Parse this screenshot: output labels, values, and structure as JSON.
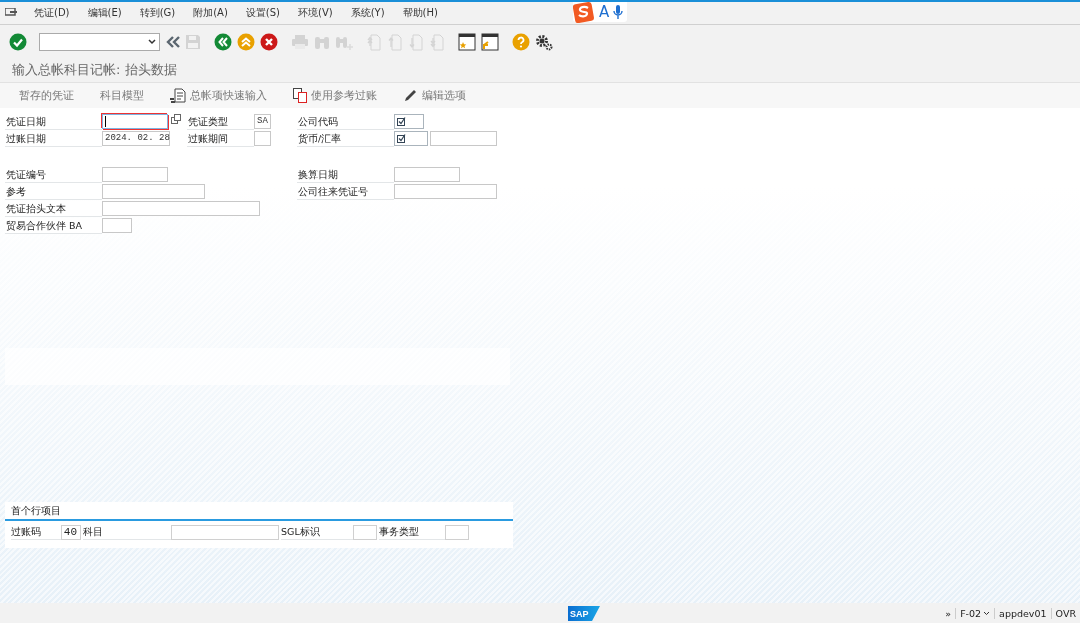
{
  "menu": [
    "凭证(D)",
    "编辑(E)",
    "转到(G)",
    "附加(A)",
    "设置(S)",
    "环境(V)",
    "系统(Y)",
    "帮助(H)"
  ],
  "ime": {
    "mode": "A"
  },
  "toolbar": [
    {
      "kind": "enter",
      "disabled": false
    },
    {
      "kind": "command-field"
    },
    {
      "kind": "collapse",
      "disabled": false
    },
    {
      "kind": "save",
      "disabled": true
    },
    {
      "kind": "back",
      "disabled": false
    },
    {
      "kind": "exit",
      "disabled": false
    },
    {
      "kind": "cancel",
      "disabled": false
    },
    {
      "kind": "print",
      "disabled": true
    },
    {
      "kind": "find",
      "disabled": true
    },
    {
      "kind": "find-next",
      "disabled": true
    },
    {
      "kind": "first-page",
      "disabled": true
    },
    {
      "kind": "prev-page",
      "disabled": true
    },
    {
      "kind": "next-page",
      "disabled": true
    },
    {
      "kind": "last-page",
      "disabled": true
    },
    {
      "kind": "new-session",
      "disabled": false
    },
    {
      "kind": "shortcut",
      "disabled": false
    },
    {
      "kind": "help",
      "disabled": false
    },
    {
      "kind": "settings",
      "disabled": false
    }
  ],
  "title": "输入总帐科目记帐: 抬头数据",
  "app_toolbar": [
    "暂存的凭证",
    "科目模型",
    "总帐项快速输入",
    "使用参考过账",
    "编辑选项"
  ],
  "header_rows": [
    [
      {
        "label": "凭证日期",
        "fields": [
          {
            "focused": true,
            "required": false
          }
        ],
        "value_help": true
      },
      {
        "label": "凭证类型",
        "fields": [
          {
            "value": "SA",
            "focused": false,
            "required": false
          }
        ]
      },
      {
        "label": "公司代码",
        "fields": [
          {
            "focused": false,
            "required": true
          }
        ]
      }
    ],
    [
      {
        "label": "过账日期",
        "fields": [
          {
            "value": "2024. 02. 28",
            "focused": false,
            "required": false
          }
        ]
      },
      {
        "label": "过账期间",
        "fields": [
          {
            "focused": false,
            "required": false
          }
        ]
      },
      {
        "label": "货币/汇率",
        "fields": [
          {
            "focused": false,
            "required": true
          },
          {
            "focused": false,
            "required": false
          }
        ]
      }
    ],
    [],
    [
      {
        "label": "凭证编号",
        "fields": [
          {
            "focused": false,
            "required": false
          }
        ]
      },
      {
        "label": "换算日期",
        "fields": [
          {
            "focused": false,
            "required": false
          }
        ]
      }
    ],
    [
      {
        "label": "参考",
        "fields": [
          {
            "focused": false,
            "required": false
          }
        ]
      },
      {
        "label": "公司往来凭证号",
        "fields": [
          {
            "focused": false,
            "required": false
          }
        ]
      }
    ],
    [
      {
        "label": "凭证抬头文本",
        "fields": [
          {
            "focused": false,
            "required": false
          }
        ]
      }
    ],
    [
      {
        "label": "贸易合作伙伴 BA",
        "fields": [
          {
            "focused": false,
            "required": false
          }
        ]
      }
    ]
  ],
  "first_line_item": {
    "title": "首个行项目",
    "fields": [
      {
        "label": "过账码",
        "value": "40"
      },
      {
        "label": "科目"
      },
      {
        "label": "SGL标识"
      },
      {
        "label": "事务类型"
      }
    ]
  },
  "status_bar": {
    "logo": "SAP",
    "items": [
      "»",
      "F-02",
      "appdev01",
      "OVR"
    ]
  }
}
